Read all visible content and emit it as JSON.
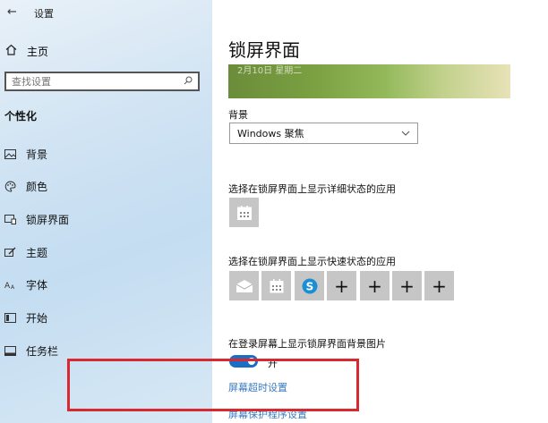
{
  "window": {
    "back_glyph": "←",
    "title": "设置"
  },
  "sidebar": {
    "home_label": "主页",
    "search_placeholder": "查找设置",
    "section_title": "个性化",
    "items": [
      {
        "label": "背景",
        "icon": "picture-icon"
      },
      {
        "label": "颜色",
        "icon": "palette-icon"
      },
      {
        "label": "锁屏界面",
        "icon": "lock-screen-icon"
      },
      {
        "label": "主题",
        "icon": "brush-icon"
      },
      {
        "label": "字体",
        "icon": "font-icon"
      },
      {
        "label": "开始",
        "icon": "start-icon"
      },
      {
        "label": "任务栏",
        "icon": "taskbar-icon"
      }
    ]
  },
  "main": {
    "title": "锁屏界面",
    "preview_ghost_text": "2月10日 星期二",
    "background_label": "背景",
    "background_value": "Windows 聚焦",
    "detailed_status_label": "选择在锁屏界面上显示详细状态的应用",
    "quick_status_label": "选择在锁屏界面上显示快速状态的应用",
    "quick_status_apps": [
      "mail-icon",
      "calendar-icon",
      "skype-icon",
      "add-icon",
      "add-icon",
      "add-icon",
      "add-icon"
    ],
    "toggle_label": "在登录屏幕上显示锁屏界面背景图片",
    "toggle_state": "开",
    "toggle_on": true,
    "link_timeout": "屏幕超时设置",
    "link_screensaver": "屏幕保护程序设置"
  },
  "colors": {
    "accent": "#1a6fc4",
    "tile": "#c6c6c6",
    "highlight_box": "#d9282f",
    "link": "#3a7bc2"
  }
}
